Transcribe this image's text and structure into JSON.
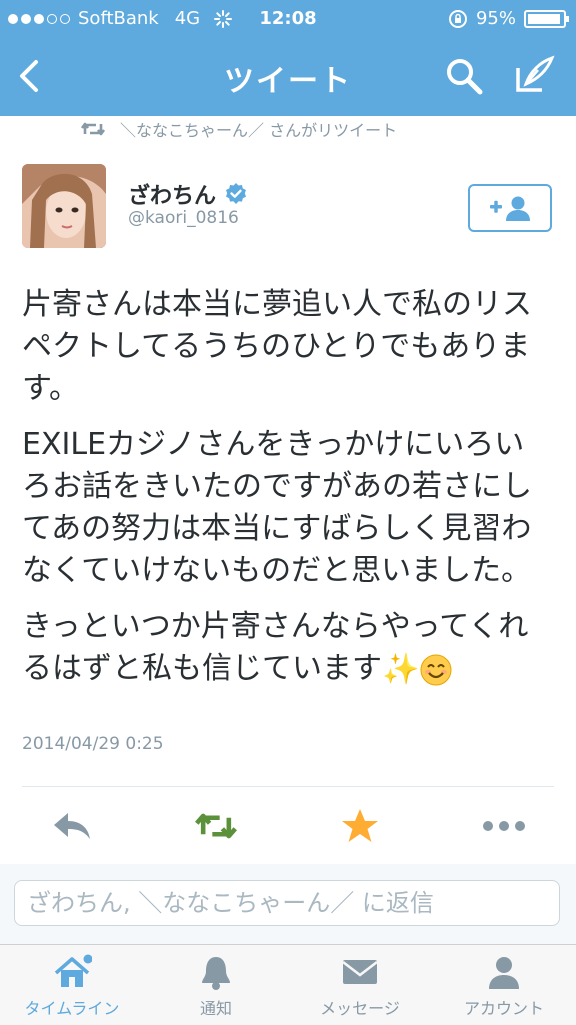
{
  "status_bar": {
    "carrier": "SoftBank",
    "network": "4G",
    "time": "12:08",
    "battery": "95%"
  },
  "nav": {
    "title": "ツイート"
  },
  "retweet_note": "＼ななこちゃーん／ さんがリツイート",
  "author": {
    "name": "ざわちん",
    "handle": "@kaori_0816"
  },
  "tweet": {
    "paragraph1": "片寄さんは本当に夢追い人で私のリスペクトしてるうちのひとりでもあります。",
    "paragraph2": "EXILEカジノさんをきっかけにいろいろお話をきいたのですがあの若さにしてあの努力は本当にすばらしく見習わなくていけないものだと思いました。",
    "paragraph3": "きっといつか片寄さんならやってくれるはずと私も信じています",
    "emoji_sparkles": "✨",
    "timestamp": "2014/04/29 0:25"
  },
  "reply": {
    "placeholder": "ざわちん, ＼ななこちゃーん／ に返信"
  },
  "tabs": [
    {
      "label": "タイムライン"
    },
    {
      "label": "通知"
    },
    {
      "label": "メッセージ"
    },
    {
      "label": "アカウント"
    }
  ],
  "colors": {
    "brand_blue": "#5ea9dd",
    "retweet_green": "#5c913b",
    "favorite_gold": "#ffac33",
    "muted_gray": "#8899a6"
  },
  "icons": [
    "back-icon",
    "search-icon",
    "compose-icon",
    "retweet-icon",
    "verified-icon",
    "follow-icon",
    "reply-icon",
    "favorite-icon",
    "more-icon",
    "home-icon",
    "notifications-icon",
    "messages-icon",
    "account-icon"
  ]
}
